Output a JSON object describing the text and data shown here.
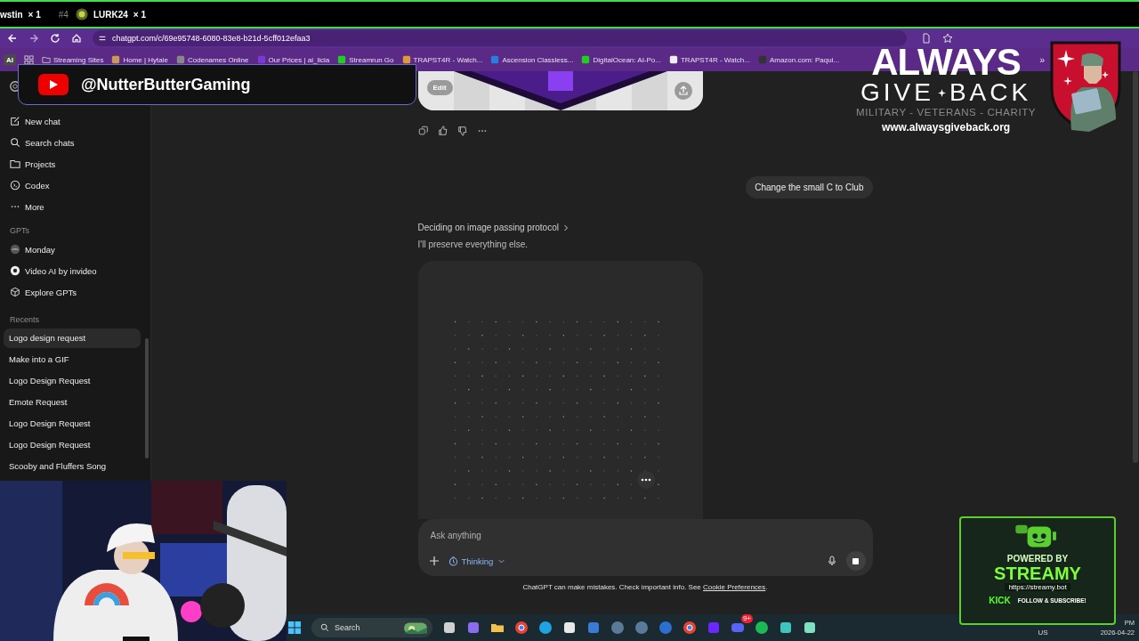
{
  "stream_bar": {
    "first_name": "wstin",
    "first_count": "× 1",
    "rank": "#4",
    "second_name": "LURK24",
    "second_count": "× 1"
  },
  "browser": {
    "url": "chatgpt.com/c/69e95748-6080-83e8-b21d-5cff012efaa3"
  },
  "bookmarks": {
    "ai_label": "AI",
    "overflow": "»",
    "items": [
      {
        "kind": "folder",
        "label": "Streaming Sites"
      },
      {
        "kind": "site",
        "label": "Home | Hytale"
      },
      {
        "kind": "site",
        "label": "Codenames Online"
      },
      {
        "kind": "site",
        "label": "Our Prices | ai_licia"
      },
      {
        "kind": "site",
        "label": "Streamrun Go"
      },
      {
        "kind": "site",
        "label": "TRAPST4R - Watch..."
      },
      {
        "kind": "site",
        "label": "Ascension Classless..."
      },
      {
        "kind": "site",
        "label": "DigitalOcean: AI-Po..."
      },
      {
        "kind": "site",
        "label": "TRAPST4R - Watch..."
      },
      {
        "kind": "site",
        "label": "Amazon.com: Paqui..."
      }
    ]
  },
  "sidebar": {
    "nav": [
      {
        "kind": "new",
        "label": "New chat"
      },
      {
        "kind": "search",
        "label": "Search chats"
      },
      {
        "kind": "projects",
        "label": "Projects"
      },
      {
        "kind": "codex",
        "label": "Codex"
      },
      {
        "kind": "more",
        "label": "More"
      }
    ],
    "gpts_heading": "GPTs",
    "gpts": [
      {
        "kind": "avatar",
        "label": "Monday"
      },
      {
        "kind": "badge",
        "label": "Video AI by invideo"
      },
      {
        "kind": "explore",
        "label": "Explore GPTs"
      }
    ],
    "recents_heading": "Recents",
    "recents": [
      {
        "label": "Logo design request",
        "selected": true
      },
      {
        "label": "Make into a GIF",
        "selected": false
      },
      {
        "label": "Logo Design Request",
        "selected": false
      },
      {
        "label": "Emote Request",
        "selected": false
      },
      {
        "label": "Logo Design Request",
        "selected": false
      },
      {
        "label": "Logo Design Request",
        "selected": false
      },
      {
        "label": "Scooby and Fluffers Song",
        "selected": false
      }
    ]
  },
  "chat": {
    "image_card": {
      "edit": "Edit"
    },
    "user_message": "Change the small C to Club",
    "thinking": {
      "title": "Deciding on image passing protocol",
      "body": "I'll preserve everything else."
    },
    "composer": {
      "placeholder": "Ask anything",
      "mode": "Thinking"
    },
    "footer": {
      "text": "ChatGPT can make mistakes. Check important info. See",
      "link": "Cookie Preferences",
      "end": "."
    }
  },
  "taskbar": {
    "search_placeholder": "Search",
    "badge": "9+",
    "language": "US",
    "date": "2026-04-22",
    "time": "PM"
  },
  "overlays": {
    "youtube_handle": "@NutterButterGaming",
    "charity": {
      "title": "ALWAYS",
      "give": "GIVE",
      "back": "BACK",
      "tagline": "MILITARY - VETERANS - CHARITY",
      "url": "www.alwaysgiveback.org"
    },
    "streamy": {
      "powered": "POWERED BY",
      "name": "STREAMY",
      "url": "https://streamy.bot",
      "kick": "KICK",
      "cta": "FOLLOW & SUBSCRIBE!"
    }
  }
}
